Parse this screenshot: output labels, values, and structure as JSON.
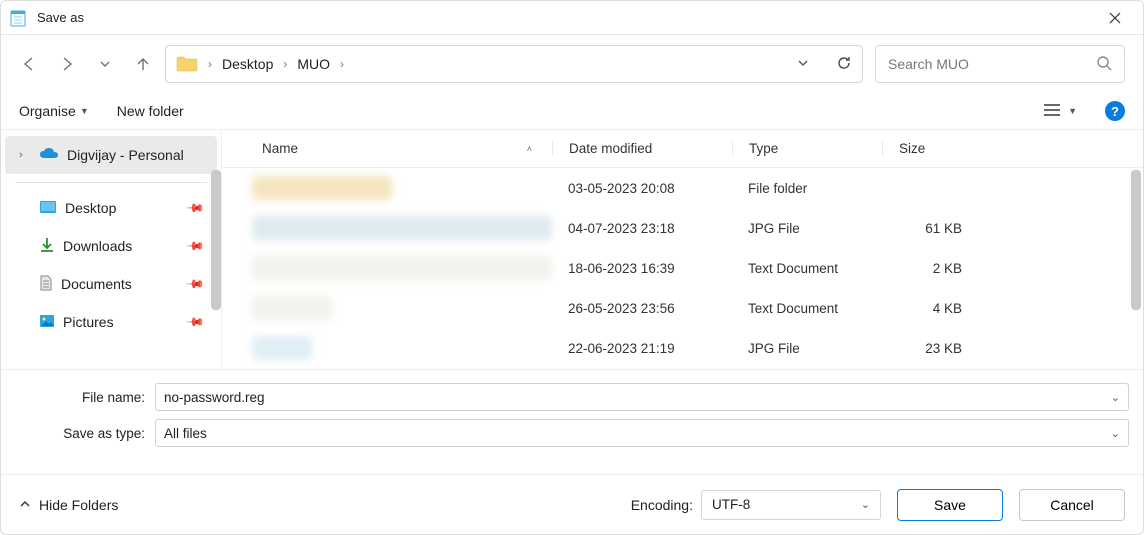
{
  "window": {
    "title": "Save as"
  },
  "nav": {
    "breadcrumb": [
      "Desktop",
      "MUO"
    ]
  },
  "search": {
    "placeholder": "Search MUO"
  },
  "toolbar": {
    "organise": "Organise",
    "newfolder": "New folder"
  },
  "sidebar": {
    "onedrive": "Digvijay - Personal",
    "items": [
      {
        "label": "Desktop"
      },
      {
        "label": "Downloads"
      },
      {
        "label": "Documents"
      },
      {
        "label": "Pictures"
      }
    ]
  },
  "columns": {
    "name": "Name",
    "date": "Date modified",
    "type": "Type",
    "size": "Size"
  },
  "rows": [
    {
      "date": "03-05-2023 20:08",
      "type": "File folder",
      "size": ""
    },
    {
      "date": "04-07-2023 23:18",
      "type": "JPG File",
      "size": "61 KB"
    },
    {
      "date": "18-06-2023 16:39",
      "type": "Text Document",
      "size": "2 KB"
    },
    {
      "date": "26-05-2023 23:56",
      "type": "Text Document",
      "size": "4 KB"
    },
    {
      "date": "22-06-2023 21:19",
      "type": "JPG File",
      "size": "23 KB"
    }
  ],
  "fields": {
    "filename_label": "File name:",
    "filename_value": "no-password.reg",
    "saveastype_label": "Save as type:",
    "saveastype_value": "All files"
  },
  "bottom": {
    "hidefolders": "Hide Folders",
    "encoding_label": "Encoding:",
    "encoding_value": "UTF-8",
    "save": "Save",
    "cancel": "Cancel"
  }
}
